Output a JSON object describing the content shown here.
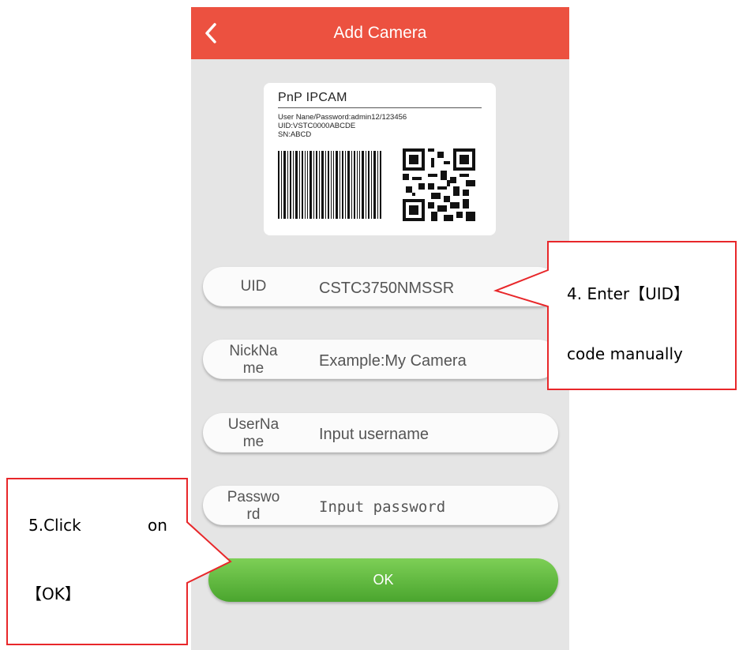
{
  "app": {
    "title": "Add Camera",
    "icons": {
      "back": "chevron-left-icon"
    },
    "colors": {
      "header": "#ec5140",
      "ok_button": "#5cb83c",
      "callout_border": "#e8272a"
    }
  },
  "camera_label": {
    "title": "PnP IPCAM",
    "lines": [
      "User Nane/Password:admin12/123456",
      "UID:VSTC0000ABCDE",
      "SN:ABCD"
    ],
    "icons": {
      "barcode": "barcode-icon",
      "qrcode": "qr-code-icon"
    }
  },
  "form": {
    "uid": {
      "label": "UID",
      "value": "CSTC3750NMSSR"
    },
    "nickname": {
      "label": "NickName",
      "placeholder": "Example:My Camera"
    },
    "username": {
      "label": "UserName",
      "placeholder": "Input username"
    },
    "password": {
      "label": "Password",
      "placeholder": "Input password"
    },
    "ok_label": "OK"
  },
  "callouts": {
    "uid_step": {
      "line1": "4. Enter【UID】",
      "line2": "code manually"
    },
    "ok_step": {
      "line1": "5.Click",
      "line1b": "on",
      "line2": "【OK】"
    }
  }
}
